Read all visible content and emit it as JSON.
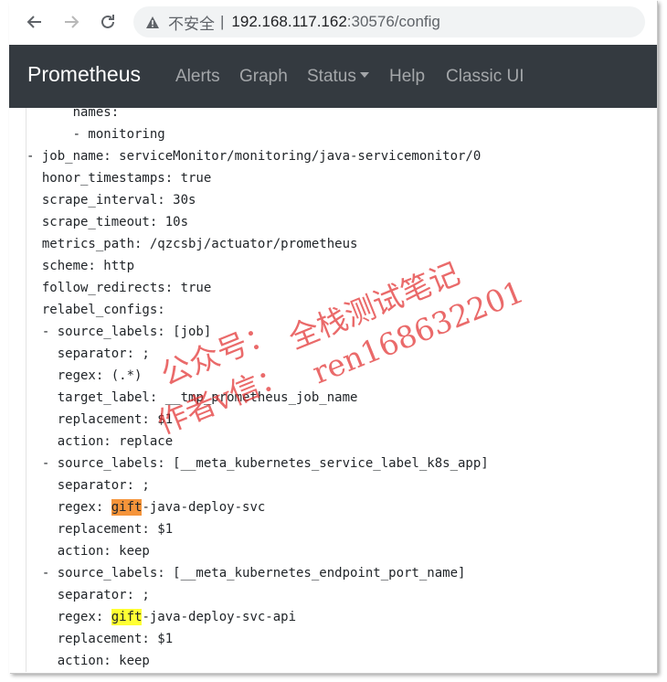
{
  "browser": {
    "security_label": "不安全",
    "separator": "|",
    "url_host": "192.168.117.162",
    "url_rest": ":30576/config"
  },
  "navbar": {
    "brand": "Prometheus",
    "links": [
      "Alerts",
      "Graph",
      "Status",
      "Help",
      "Classic UI"
    ]
  },
  "config_lines": [
    "      names:",
    "      - monitoring",
    "- job_name: serviceMonitor/monitoring/java-servicemonitor/0",
    "  honor_timestamps: true",
    "  scrape_interval: 30s",
    "  scrape_timeout: 10s",
    "  metrics_path: /qzcsbj/actuator/prometheus",
    "  scheme: http",
    "  follow_redirects: true",
    "  relabel_configs:",
    "  - source_labels: [job]",
    "    separator: ;",
    "    regex: (.*)",
    "    target_label: __tmp_prometheus_job_name",
    "    replacement: $1",
    "    action: replace",
    "  - source_labels: [__meta_kubernetes_service_label_k8s_app]",
    "    separator: ;",
    "    regex: ",
    "    replacement: $1",
    "    action: keep",
    "  - source_labels: [__meta_kubernetes_endpoint_port_name]",
    "    separator: ;",
    "    regex: ",
    "    replacement: $1",
    "    action: keep"
  ],
  "highlights": [
    {
      "line": 18,
      "text": "gift",
      "suffix": "-java-deploy-svc",
      "color": "#f5943a"
    },
    {
      "line": 23,
      "text": "gift",
      "suffix": "-java-deploy-svc-api",
      "color": "#ffff33"
    }
  ],
  "watermark": {
    "line1": "全栈测试笔记",
    "line2": "公众号：",
    "line3": "ren168632201",
    "line4": "作者v信：",
    "color": "#e23030"
  }
}
